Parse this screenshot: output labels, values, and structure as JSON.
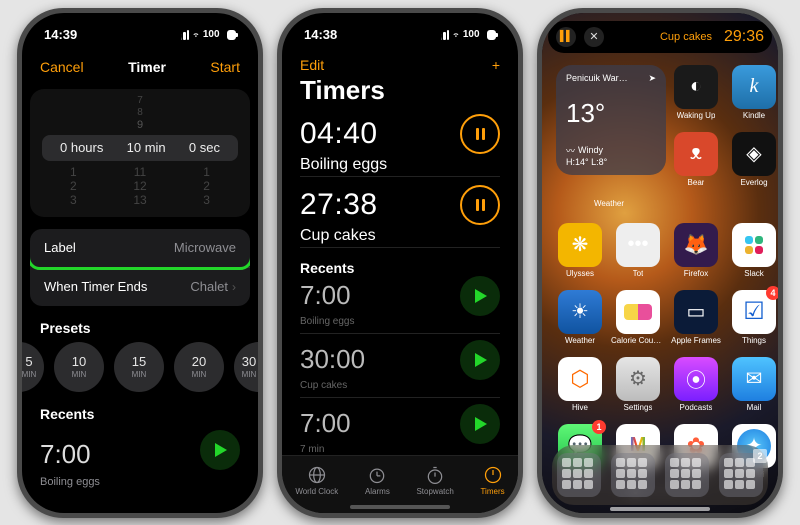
{
  "phone1": {
    "status": {
      "time": "14:39",
      "battery": "100"
    },
    "nav": {
      "cancel": "Cancel",
      "title": "Timer",
      "start": "Start"
    },
    "picker": {
      "faded_top": [
        "7",
        "8",
        "9"
      ],
      "selected": {
        "hours": "0 hours",
        "min": "10 min",
        "sec": "0 sec"
      },
      "below1": [
        "1",
        "11",
        "1"
      ],
      "below2": [
        "2",
        "12",
        "2"
      ],
      "below3": [
        "3",
        "13",
        "3"
      ]
    },
    "settings": {
      "label_key": "Label",
      "label_val": "Microwave",
      "end_key": "When Timer Ends",
      "end_val": "Chalet"
    },
    "presets_h": "Presets",
    "presets": [
      {
        "n": "5",
        "u": "MIN"
      },
      {
        "n": "10",
        "u": "MIN"
      },
      {
        "n": "15",
        "u": "MIN"
      },
      {
        "n": "20",
        "u": "MIN"
      },
      {
        "n": "30",
        "u": "MIN"
      }
    ],
    "recents_h": "Recents",
    "recent": {
      "time": "7:00",
      "label": "Boiling eggs"
    }
  },
  "phone2": {
    "status": {
      "time": "14:38",
      "battery": "100"
    },
    "nav": {
      "edit": "Edit",
      "plus": "+"
    },
    "title": "Timers",
    "active": [
      {
        "time": "04:40",
        "label": "Boiling eggs"
      },
      {
        "time": "27:38",
        "label": "Cup cakes"
      }
    ],
    "recents_h": "Recents",
    "recents": [
      {
        "time": "7:00",
        "label": "Boiling eggs"
      },
      {
        "time": "30:00",
        "label": "Cup cakes"
      },
      {
        "time": "7:00",
        "label": "7 min"
      }
    ],
    "tabs": {
      "world": "World Clock",
      "alarms": "Alarms",
      "stopwatch": "Stopwatch",
      "timers": "Timers"
    }
  },
  "phone3": {
    "island": {
      "label": "Cup cakes",
      "time": "29:36"
    },
    "widget": {
      "loc": "Penicuik War…",
      "temp": "13°",
      "cond": "Windy",
      "range": "H:14° L:8°",
      "label": "Weather"
    },
    "apps_row1": [
      {
        "name": "Waking Up",
        "cls": "bg-wakingup",
        "glyph": "◐"
      },
      {
        "name": "Kindle",
        "cls": "bg-kindle",
        "glyph": "k"
      }
    ],
    "apps_row2": [
      {
        "name": "Bear",
        "cls": "bg-bear",
        "glyph": "ᴥ"
      },
      {
        "name": "Everlog",
        "cls": "bg-everlog",
        "glyph": "◈"
      }
    ],
    "apps_rows": [
      [
        {
          "name": "Ulysses",
          "cls": "bg-ulysses",
          "glyph": "❋"
        },
        {
          "name": "Tot",
          "cls": "bg-tot",
          "glyph": "•••"
        },
        {
          "name": "Firefox",
          "cls": "bg-firefox",
          "glyph": "🦊"
        },
        {
          "name": "Slack",
          "cls": "bg-slack",
          "glyph": ""
        }
      ],
      [
        {
          "name": "Weather",
          "cls": "bg-weather",
          "glyph": "☀"
        },
        {
          "name": "Calorie Counter",
          "cls": "bg-calorie",
          "glyph": "◉"
        },
        {
          "name": "Apple Frames",
          "cls": "bg-frames",
          "glyph": "▭"
        },
        {
          "name": "Things",
          "cls": "bg-things",
          "glyph": "☑",
          "badge": "4"
        }
      ],
      [
        {
          "name": "Hive",
          "cls": "bg-hive",
          "glyph": "⬡"
        },
        {
          "name": "Settings",
          "cls": "bg-settings",
          "glyph": "⚙"
        },
        {
          "name": "Podcasts",
          "cls": "bg-podcasts",
          "glyph": "⦿"
        },
        {
          "name": "Mail",
          "cls": "bg-mail",
          "glyph": "✉"
        }
      ],
      [
        {
          "name": "Messages",
          "cls": "bg-messages",
          "glyph": "💬",
          "badge": "1"
        },
        {
          "name": "Gmail",
          "cls": "bg-gmail",
          "glyph": "M"
        },
        {
          "name": "Photos",
          "cls": "bg-photos",
          "glyph": "✿"
        },
        {
          "name": "Safari",
          "cls": "bg-safari",
          "glyph": "🧭"
        }
      ]
    ],
    "dock_badges": [
      "",
      "",
      "",
      "2"
    ]
  }
}
